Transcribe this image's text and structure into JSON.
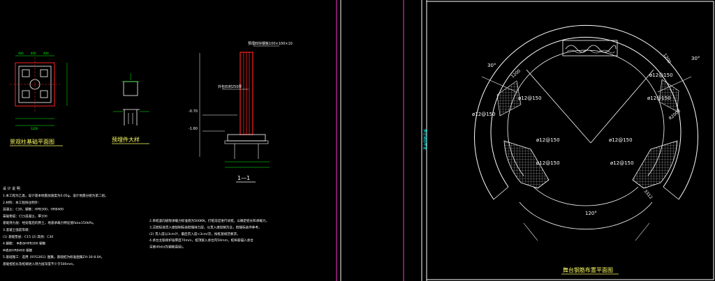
{
  "colors": {
    "background": "#000000",
    "line": "#ffffff",
    "red": "#ff2020",
    "magenta": "#ff33cc",
    "cyan": "#00ffff",
    "green": "#00ff00",
    "yellow": "#ffff00",
    "title": "#ffff66"
  },
  "left_sheet": {
    "plan_title": "景观柱基础平面图",
    "embed_title": "预埋件大样",
    "section_title": "1—1",
    "plan_dims_top": [
      "400",
      "400",
      "400"
    ],
    "plan_dims_bottom": [
      "1200"
    ],
    "section_label_top": "预埋四块钢板100×100×10",
    "section_label_mid": "外包石材250厚",
    "section_elev_1": "-0.70",
    "section_elev_2": "-1.60",
    "notes_heading": "设 计 说 明",
    "notes_left": [
      "1.本工程为乙类，设计基本地震加速度为0.05g，设计地震分组为第二组。",
      "2.材料：本工程除注明外：",
      "  混凝土：C30，钢筋：HPB300、HRB400",
      "  基础垫层：C15混凝土，厚100",
      "  基础持力层：经处理后的原土，地基承载力特征值fak≥150kPa。",
      "3.混凝土强度等级：",
      "  (1) 基础垫层：C15    (2) 其他：C30",
      "4.钢筋：  Φ表示HPB300 钢筋",
      "  Ф表示HRB400 钢筋",
      "5.基础施工：选用《97G361》图集，基础桩为标准图集ZH-30-8.0A。",
      "  基础桩桩长及桩端进入持力层深度不少于500mm。"
    ],
    "notes_right": [
      "2.单桩竖向极限承载力标准值为500KN，打桩前应进行试桩，以确定桩长和承载力。",
      "3.沉桩标准贯入度控制标高桩端持力层，以贯入度控制为主，桩端标高作参考。",
      "  (2) 贯入度以3cm计，最后贯入度<3cm/次，按桩基规范要求。",
      "4.承台主筋保护层厚度70mm，桩顶嵌入承台内50mm，桩纵筋锚入承台",
      "  深度40d(d为钢筋直径)。"
    ]
  },
  "right_sheet": {
    "title": "舞台钢筋布置平面图",
    "angle_left": "30°",
    "angle_right": "30°",
    "angle_bottom": "120°",
    "rebar_labels": [
      "ø12@150",
      "ø12@150",
      "ø12@150",
      "ø12@150",
      "ø12@150",
      "ø12@150",
      "ø12@150",
      "ø12@150"
    ],
    "dim_labels": [
      "1200",
      "1200",
      "R2000",
      "3312"
    ]
  },
  "divider_text": "舞台钢筋布置"
}
